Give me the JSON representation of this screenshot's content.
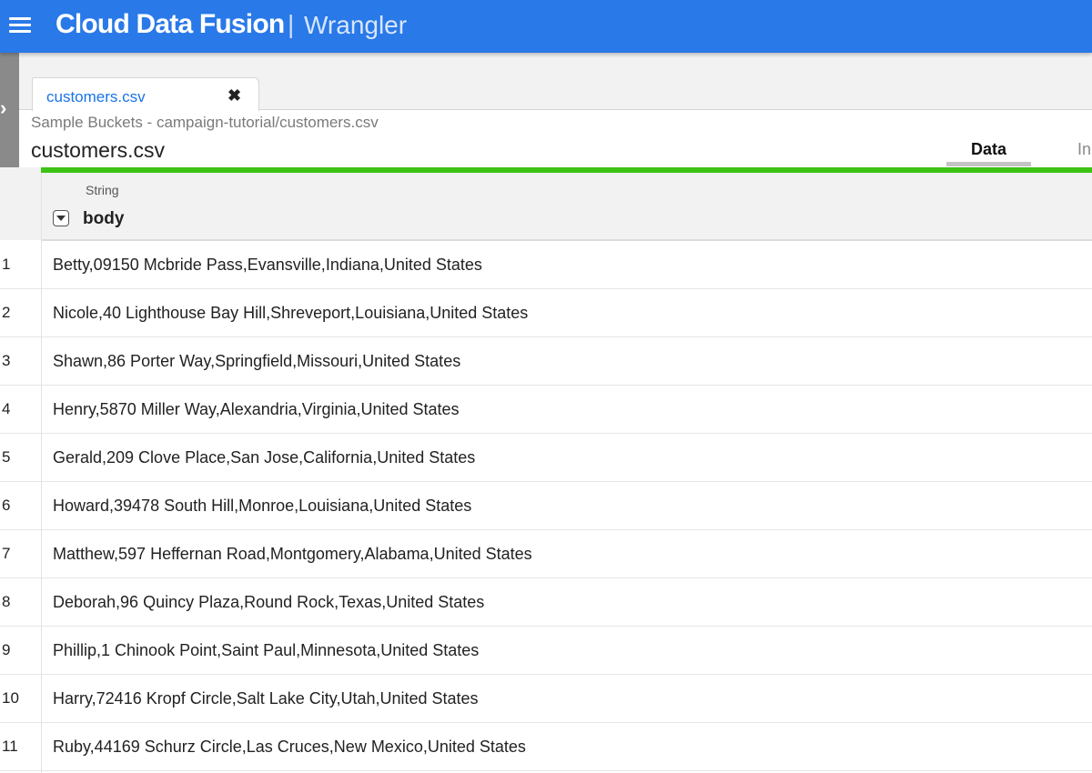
{
  "app": {
    "title": "Cloud Data Fusion",
    "separator": "|",
    "subtitle": "Wrangler"
  },
  "tab": {
    "label": "customers.csv",
    "close": "✖"
  },
  "breadcrumb": "Sample Buckets - campaign-tutorial/customers.csv",
  "file_title": "customers.csv",
  "view_tabs": {
    "data": "Data",
    "insights_partial": "In"
  },
  "column": {
    "type": "String",
    "name": "body"
  },
  "rows": [
    {
      "num": "1",
      "body": "Betty,09150 Mcbride Pass,Evansville,Indiana,United States"
    },
    {
      "num": "2",
      "body": "Nicole,40 Lighthouse Bay Hill,Shreveport,Louisiana,United States"
    },
    {
      "num": "3",
      "body": "Shawn,86 Porter Way,Springfield,Missouri,United States"
    },
    {
      "num": "4",
      "body": "Henry,5870 Miller Way,Alexandria,Virginia,United States"
    },
    {
      "num": "5",
      "body": "Gerald,209 Clove Place,San Jose,California,United States"
    },
    {
      "num": "6",
      "body": "Howard,39478 South Hill,Monroe,Louisiana,United States"
    },
    {
      "num": "7",
      "body": "Matthew,597 Heffernan Road,Montgomery,Alabama,United States"
    },
    {
      "num": "8",
      "body": "Deborah,96 Quincy Plaza,Round Rock,Texas,United States"
    },
    {
      "num": "9",
      "body": "Phillip,1 Chinook Point,Saint Paul,Minnesota,United States"
    },
    {
      "num": "10",
      "body": "Harry,72416 Kropf Circle,Salt Lake City,Utah,United States"
    },
    {
      "num": "11",
      "body": "Ruby,44169 Schurz Circle,Las Cruces,New Mexico,United States"
    }
  ],
  "colors": {
    "topbar": "#2979e8",
    "progress": "#3ec216",
    "tab_link": "#1a73e8"
  },
  "icons": {
    "menu": "hamburger-menu-icon",
    "sidebar_toggle": "chevron-right-icon",
    "close": "close-icon",
    "column_dropdown": "caret-down-icon"
  }
}
